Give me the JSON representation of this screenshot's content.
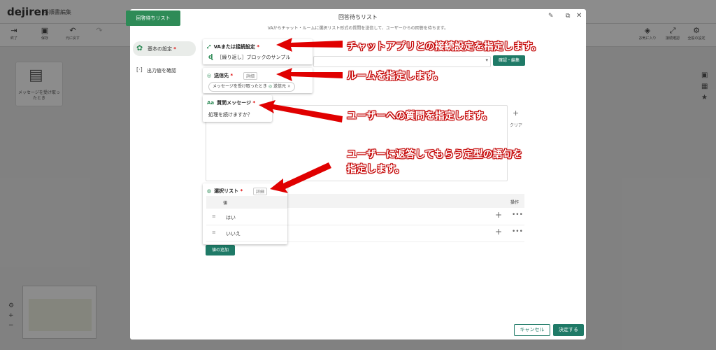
{
  "app": {
    "logo": "dejiren",
    "title": "手順書編集"
  },
  "toolbar": {
    "end": "終了",
    "save": "保存",
    "undo": "元に戻す",
    "redo": "",
    "favorite": "お気に入り",
    "connection": "接続確認",
    "settings": "全般の設定"
  },
  "node": {
    "label": "メッセージを受け取ったとき"
  },
  "modal": {
    "tab": "回答待ちリスト",
    "title": "回答待ちリスト",
    "description": "VAからチャット・ルームに選択リスト形式の質問を送信して、ユーザーからの回答を待ちます。",
    "side_basic": "基本の設定",
    "side_basic_req": "*",
    "side_output": "出力値を確認",
    "confirm_edit": "確認・編集",
    "clear": "クリア",
    "operation": "操作",
    "add_value": "値の追加",
    "cancel": "キャンセル",
    "decide": "決定する"
  },
  "cards": {
    "connection": {
      "title": "VAまたは接続設定",
      "req": "*",
      "value": "［繰り返し］ブロックのサンプル"
    },
    "destination": {
      "title": "送信先",
      "req": "*",
      "detail": "詳細",
      "chip": "メッセージを受け取ったとき",
      "chip_tag": "送信元"
    },
    "question": {
      "title": "質問メッセージ",
      "req": "*",
      "value": "処理を続けますか？"
    },
    "choice": {
      "title": "選択リスト",
      "req": "*",
      "detail": "詳細",
      "col": "値",
      "rows": [
        "はい",
        "いいえ"
      ]
    }
  },
  "notes": {
    "n1": "チャットアプリとの接続設定を指定します。",
    "n2": "ルームを指定します。",
    "n3": "ユーザーへの質問を指定します。",
    "n4a": "ユーザーに返答してもらう定型の語句を",
    "n4b": "指定します。"
  }
}
